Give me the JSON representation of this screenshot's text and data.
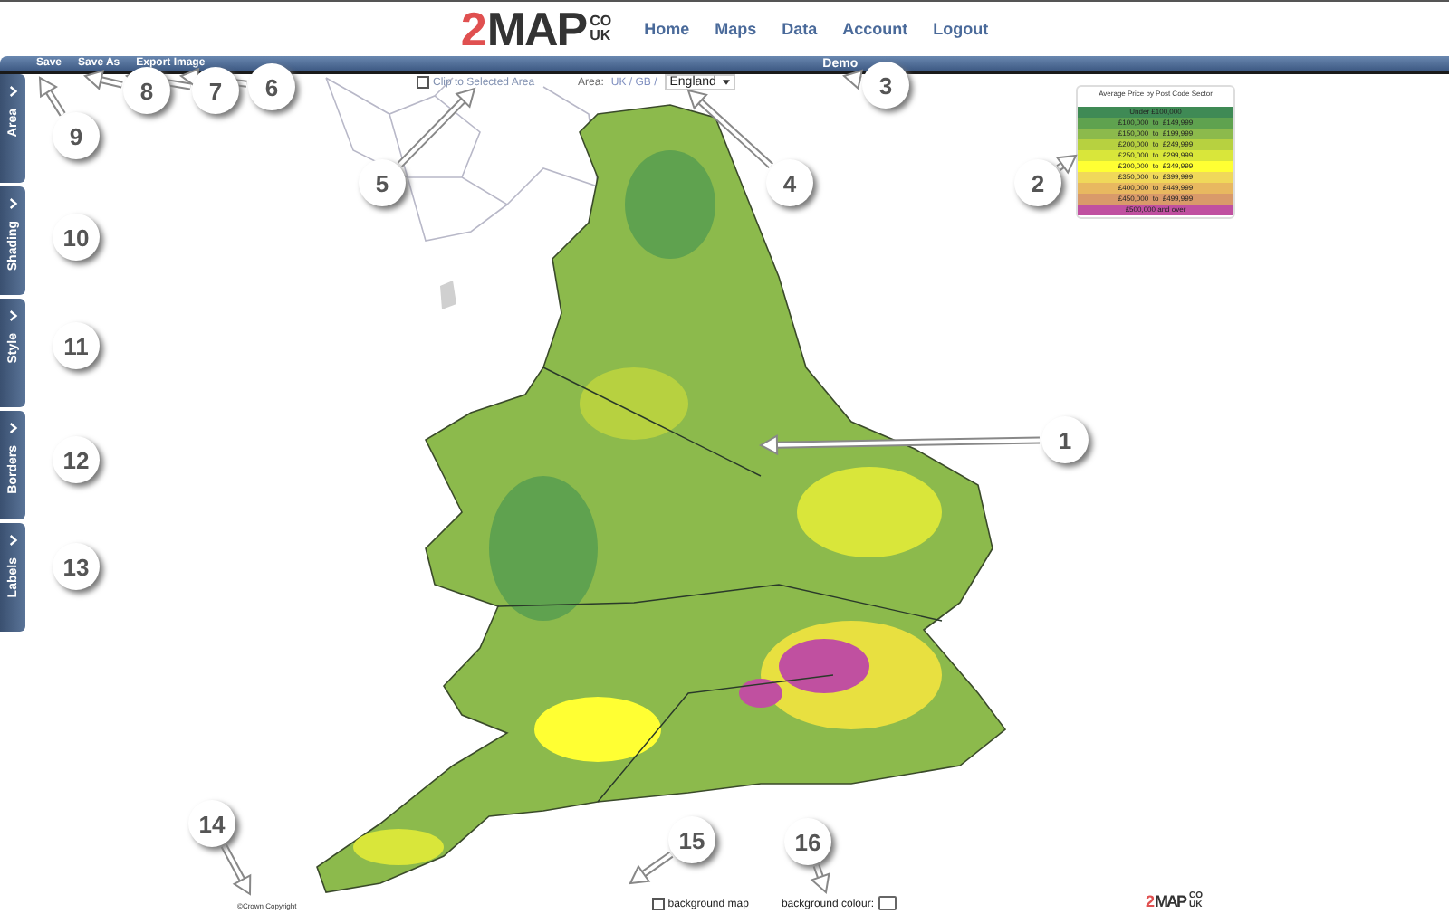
{
  "header": {
    "logo": {
      "mark": "2",
      "name": "MAP",
      "tld_top": "CO",
      "tld_bottom": "UK"
    },
    "nav": [
      "Home",
      "Maps",
      "Data",
      "Account",
      "Logout"
    ]
  },
  "toolbar": {
    "actions": [
      "Save",
      "Save As",
      "Export Image"
    ],
    "title": "Demo"
  },
  "sidebar": {
    "tabs": [
      "Area",
      "Shading",
      "Style",
      "Borders",
      "Labels"
    ]
  },
  "map_options": {
    "clip": {
      "label": "Clip to Selected Area",
      "checked": false
    },
    "area_label": "Area:",
    "area_path": "UK / GB /",
    "area_select": "England"
  },
  "legend": {
    "title": "Average Price by Post Code Sector",
    "items": [
      {
        "label": "Under £100,000",
        "color": "#3f8a55"
      },
      {
        "label": "£100,000  to  £149,999",
        "color": "#5fa24f"
      },
      {
        "label": "£150,000  to  £199,999",
        "color": "#8cba4c"
      },
      {
        "label": "£200,000  to  £249,999",
        "color": "#b7d140"
      },
      {
        "label": "£250,000  to  £299,999",
        "color": "#d9e63a"
      },
      {
        "label": "£300,000  to  £349,999",
        "color": "#ffff33"
      },
      {
        "label": "£350,000  to  £399,999",
        "color": "#f0d85a"
      },
      {
        "label": "£400,000  to  £449,999",
        "color": "#e8b860"
      },
      {
        "label": "£450,000  to  £499,999",
        "color": "#d99a6a"
      },
      {
        "label": "£500,000 and over",
        "color": "#c050a0"
      }
    ]
  },
  "footer": {
    "copyright": "©Crown Copyright",
    "background_map": {
      "label": "background map",
      "checked": false
    },
    "background_colour_label": "background colour:",
    "logo": {
      "mark": "2",
      "name": "MAP",
      "tld_top": "CO",
      "tld_bottom": "UK"
    }
  },
  "callouts": [
    "8",
    "7",
    "6",
    "3",
    "9",
    "5",
    "4",
    "2",
    "10",
    "11",
    "1",
    "12",
    "13",
    "14",
    "15",
    "16"
  ]
}
